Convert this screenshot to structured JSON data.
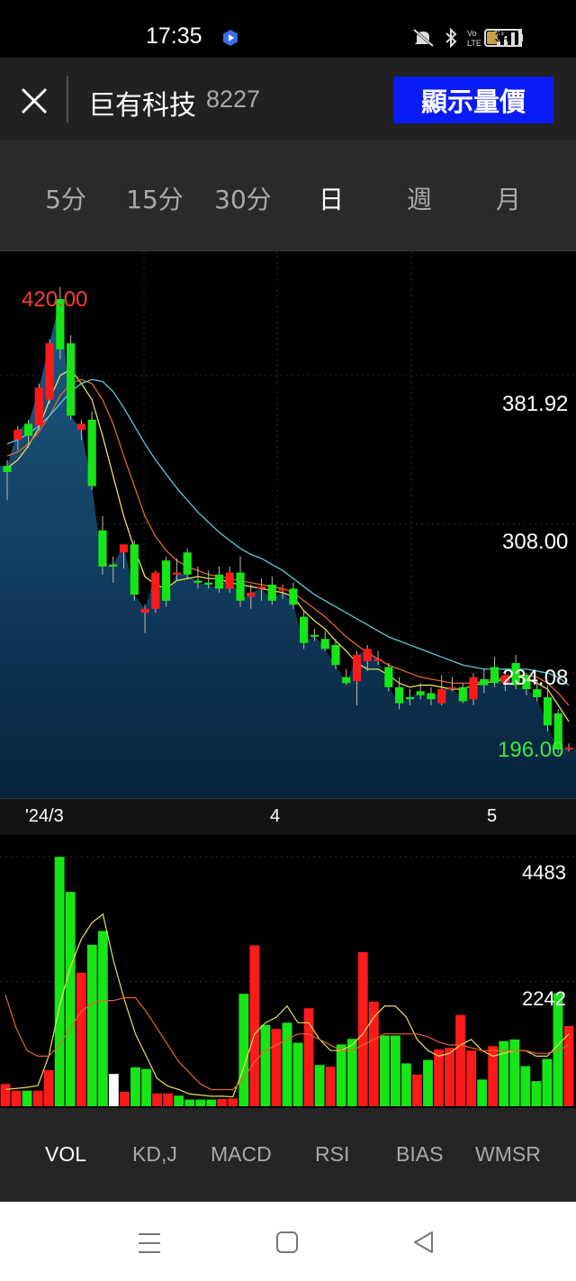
{
  "status_bar": {
    "time": "17:35",
    "battery": "34",
    "battery_level": 0.34,
    "icons": [
      "mute-icon",
      "bluetooth-icon",
      "volte-icon",
      "signal-4g-icon"
    ]
  },
  "header": {
    "stock_name": "巨有科技",
    "stock_code": "8227",
    "show_price_label": "顯示量價"
  },
  "periods": [
    {
      "label": "5分",
      "active": false
    },
    {
      "label": "15分",
      "active": false
    },
    {
      "label": "30分",
      "active": false
    },
    {
      "label": "日",
      "active": true
    },
    {
      "label": "週",
      "active": false
    },
    {
      "label": "月",
      "active": false
    }
  ],
  "chart": {
    "high_label": "420.00",
    "low_label": "196.00",
    "price_ticks": [
      "381.92",
      "308.00",
      "234.08"
    ],
    "x_labels": [
      "'24/3",
      "4",
      "5"
    ],
    "vol_ticks": [
      "4483",
      "2242"
    ]
  },
  "chart_data": {
    "type": "candlestick",
    "price_axis": [
      196.0,
      420.0
    ],
    "price_gridlines": [
      381.92,
      308.0,
      234.08
    ],
    "candles": [
      {
        "o": 334,
        "h": 340,
        "l": 320,
        "c": 337,
        "color": "green"
      },
      {
        "o": 350,
        "h": 357,
        "l": 345,
        "c": 355,
        "color": "red"
      },
      {
        "o": 352,
        "h": 360,
        "l": 346,
        "c": 358,
        "color": "green"
      },
      {
        "o": 357,
        "h": 378,
        "l": 355,
        "c": 376,
        "color": "red"
      },
      {
        "o": 370,
        "h": 400,
        "l": 368,
        "c": 398,
        "color": "red"
      },
      {
        "o": 395,
        "h": 426,
        "l": 390,
        "c": 420,
        "color": "green"
      },
      {
        "o": 398,
        "h": 402,
        "l": 360,
        "c": 362,
        "color": "green"
      },
      {
        "o": 358,
        "h": 360,
        "l": 350,
        "c": 355,
        "color": "red"
      },
      {
        "o": 360,
        "h": 364,
        "l": 325,
        "c": 327,
        "color": "green"
      },
      {
        "o": 305,
        "h": 312,
        "l": 283,
        "c": 287,
        "color": "green"
      },
      {
        "o": 287,
        "h": 292,
        "l": 279,
        "c": 288,
        "color": "green"
      },
      {
        "o": 294,
        "h": 298,
        "l": 286,
        "c": 298,
        "color": "red"
      },
      {
        "o": 298,
        "h": 300,
        "l": 270,
        "c": 273,
        "color": "green"
      },
      {
        "o": 264,
        "h": 268,
        "l": 254,
        "c": 266,
        "color": "red"
      },
      {
        "o": 266,
        "h": 285,
        "l": 264,
        "c": 284,
        "color": "red"
      },
      {
        "o": 290,
        "h": 292,
        "l": 267,
        "c": 270,
        "color": "green"
      },
      {
        "o": 283,
        "h": 291,
        "l": 280,
        "c": 284,
        "color": "red"
      },
      {
        "o": 294,
        "h": 296,
        "l": 281,
        "c": 283,
        "color": "green"
      },
      {
        "o": 280,
        "h": 287,
        "l": 276,
        "c": 279,
        "color": "green"
      },
      {
        "o": 279,
        "h": 285,
        "l": 276,
        "c": 278,
        "color": "green"
      },
      {
        "o": 283,
        "h": 287,
        "l": 274,
        "c": 276,
        "color": "green"
      },
      {
        "o": 276,
        "h": 287,
        "l": 274,
        "c": 284,
        "color": "red"
      },
      {
        "o": 284,
        "h": 292,
        "l": 267,
        "c": 270,
        "color": "green"
      },
      {
        "o": 272,
        "h": 278,
        "l": 266,
        "c": 274,
        "color": "red"
      },
      {
        "o": 277,
        "h": 281,
        "l": 270,
        "c": 276,
        "color": "red"
      },
      {
        "o": 278,
        "h": 282,
        "l": 268,
        "c": 270,
        "color": "green"
      },
      {
        "o": 276,
        "h": 278,
        "l": 271,
        "c": 275,
        "color": "red"
      },
      {
        "o": 276,
        "h": 279,
        "l": 266,
        "c": 268,
        "color": "green"
      },
      {
        "o": 262,
        "h": 265,
        "l": 246,
        "c": 249,
        "color": "green"
      },
      {
        "o": 253,
        "h": 256,
        "l": 250,
        "c": 253,
        "color": "green"
      },
      {
        "o": 251,
        "h": 255,
        "l": 245,
        "c": 246,
        "color": "green"
      },
      {
        "o": 248,
        "h": 251,
        "l": 236,
        "c": 238,
        "color": "green"
      },
      {
        "o": 232,
        "h": 236,
        "l": 228,
        "c": 229,
        "color": "green"
      },
      {
        "o": 230,
        "h": 245,
        "l": 218,
        "c": 243,
        "color": "red"
      },
      {
        "o": 240,
        "h": 248,
        "l": 235,
        "c": 246,
        "color": "red"
      },
      {
        "o": 240,
        "h": 245,
        "l": 238,
        "c": 241,
        "color": "red"
      },
      {
        "o": 237,
        "h": 239,
        "l": 225,
        "c": 227,
        "color": "green"
      },
      {
        "o": 227,
        "h": 232,
        "l": 216,
        "c": 219,
        "color": "green"
      },
      {
        "o": 221,
        "h": 226,
        "l": 218,
        "c": 222,
        "color": "green"
      },
      {
        "o": 223,
        "h": 229,
        "l": 221,
        "c": 225,
        "color": "green"
      },
      {
        "o": 224,
        "h": 227,
        "l": 218,
        "c": 221,
        "color": "green"
      },
      {
        "o": 219,
        "h": 233,
        "l": 218,
        "c": 226,
        "color": "red"
      },
      {
        "o": 227,
        "h": 232,
        "l": 225,
        "c": 227,
        "color": "red"
      },
      {
        "o": 227,
        "h": 229,
        "l": 219,
        "c": 220,
        "color": "green"
      },
      {
        "o": 221,
        "h": 234,
        "l": 218,
        "c": 232,
        "color": "red"
      },
      {
        "o": 231,
        "h": 236,
        "l": 224,
        "c": 228,
        "color": "green"
      },
      {
        "o": 237,
        "h": 242,
        "l": 227,
        "c": 229,
        "color": "green"
      },
      {
        "o": 229,
        "h": 236,
        "l": 225,
        "c": 233,
        "color": "red"
      },
      {
        "o": 239,
        "h": 243,
        "l": 226,
        "c": 228,
        "color": "green"
      },
      {
        "o": 233,
        "h": 234,
        "l": 223,
        "c": 226,
        "color": "green"
      },
      {
        "o": 226,
        "h": 230,
        "l": 220,
        "c": 222,
        "color": "green"
      },
      {
        "o": 222,
        "h": 228,
        "l": 205,
        "c": 208,
        "color": "green"
      },
      {
        "o": 214,
        "h": 216,
        "l": 194,
        "c": 196,
        "color": "green"
      },
      {
        "o": 197,
        "h": 199,
        "l": 195,
        "c": 197,
        "color": "red"
      }
    ],
    "ma_short": [
      336,
      340,
      347,
      356,
      370,
      382,
      385,
      378,
      370,
      352,
      332,
      312,
      296,
      282,
      278,
      276,
      280,
      281,
      282,
      281,
      281,
      279,
      278,
      277,
      276,
      275,
      274,
      272,
      265,
      260,
      256,
      250,
      245,
      239,
      236,
      236,
      233,
      229,
      227,
      228,
      228,
      227,
      226,
      226,
      228,
      229,
      230,
      231,
      233,
      231,
      229,
      226,
      218,
      210
    ],
    "ma_mid": [
      342,
      344,
      348,
      354,
      362,
      372,
      378,
      380,
      378,
      370,
      358,
      342,
      327,
      312,
      302,
      295,
      290,
      287,
      285,
      283,
      282,
      281,
      280,
      279,
      278,
      277,
      276,
      274,
      270,
      266,
      262,
      257,
      252,
      248,
      244,
      241,
      238,
      236,
      234,
      232,
      231,
      230,
      229,
      229,
      229,
      230,
      231,
      232,
      233,
      233,
      232,
      229,
      224,
      218
    ],
    "ma_long": [
      348,
      350,
      353,
      357,
      362,
      368,
      374,
      378,
      380,
      379,
      374,
      366,
      357,
      348,
      340,
      333,
      326,
      320,
      314,
      309,
      304,
      300,
      296,
      293,
      291,
      288,
      285,
      281,
      277,
      273,
      270,
      267,
      264,
      261,
      258,
      255,
      252,
      250,
      248,
      246,
      244,
      242,
      240,
      238,
      237,
      236,
      236,
      236,
      236,
      236,
      235,
      234,
      232,
      228
    ],
    "volume": {
      "axis_max": 4483,
      "ticks": [
        4483,
        2242
      ],
      "values": [
        400,
        280,
        280,
        280,
        650,
        4480,
        3850,
        2400,
        2900,
        3150,
        580,
        260,
        700,
        670,
        230,
        230,
        190,
        120,
        120,
        120,
        130,
        140,
        2020,
        2890,
        1460,
        1390,
        1500,
        1140,
        1760,
        740,
        710,
        1110,
        1210,
        2770,
        1880,
        1270,
        1270,
        770,
        570,
        830,
        1020,
        1050,
        1640,
        1000,
        480,
        1080,
        1170,
        1200,
        720,
        450,
        850,
        2030,
        1440
      ],
      "colors": [
        "red",
        "red",
        "green",
        "red",
        "red",
        "green",
        "green",
        "red",
        "green",
        "green",
        "white",
        "red",
        "green",
        "green",
        "red",
        "red",
        "green",
        "green",
        "green",
        "green",
        "red",
        "red",
        "green",
        "red",
        "green",
        "red",
        "green",
        "green",
        "red",
        "green",
        "red",
        "green",
        "green",
        "red",
        "red",
        "green",
        "green",
        "green",
        "red",
        "green",
        "red",
        "red",
        "red",
        "red",
        "green",
        "red",
        "green",
        "green",
        "green",
        "green",
        "green",
        "green",
        "red"
      ],
      "ma_a": [
        300,
        320,
        340,
        370,
        900,
        1800,
        2500,
        3000,
        3300,
        3450,
        2600,
        1900,
        1300,
        900,
        500,
        360,
        300,
        220,
        200,
        180,
        180,
        170,
        700,
        1300,
        1500,
        1600,
        1800,
        1500,
        1500,
        1200,
        1000,
        1000,
        1100,
        1300,
        1600,
        1800,
        1800,
        1600,
        1200,
        1000,
        900,
        950,
        1100,
        1200,
        1000,
        900,
        950,
        1000,
        1000,
        900,
        900,
        1100,
        1300
      ],
      "ma_b": [
        2000,
        1400,
        1000,
        900,
        900,
        1100,
        1400,
        1700,
        1850,
        1900,
        1900,
        1950,
        1950,
        1700,
        1400,
        1100,
        800,
        600,
        400,
        300,
        300,
        300,
        500,
        800,
        1000,
        1100,
        1200,
        1300,
        1300,
        1200,
        1100,
        1000,
        1000,
        1100,
        1200,
        1300,
        1300,
        1300,
        1300,
        1250,
        1150,
        1100,
        1100,
        1050,
        1000,
        1000,
        1000,
        1000,
        1000,
        950,
        950,
        1000,
        1100
      ]
    }
  },
  "indicators": [
    {
      "label": "VOL",
      "active": true
    },
    {
      "label": "KD,J",
      "active": false
    },
    {
      "label": "MACD",
      "active": false
    },
    {
      "label": "RSI",
      "active": false
    },
    {
      "label": "BIAS",
      "active": false
    },
    {
      "label": "WMSR",
      "active": false
    }
  ],
  "colors": {
    "up": "#ff1a1a",
    "down": "#16e616",
    "accent_button": "#0a1cf5",
    "ma_short": "#e8e05a",
    "ma_mid": "#e0672a",
    "ma_long": "#5cc8d8",
    "high_label": "#ff3b3b",
    "low_label": "#3ee83e"
  }
}
